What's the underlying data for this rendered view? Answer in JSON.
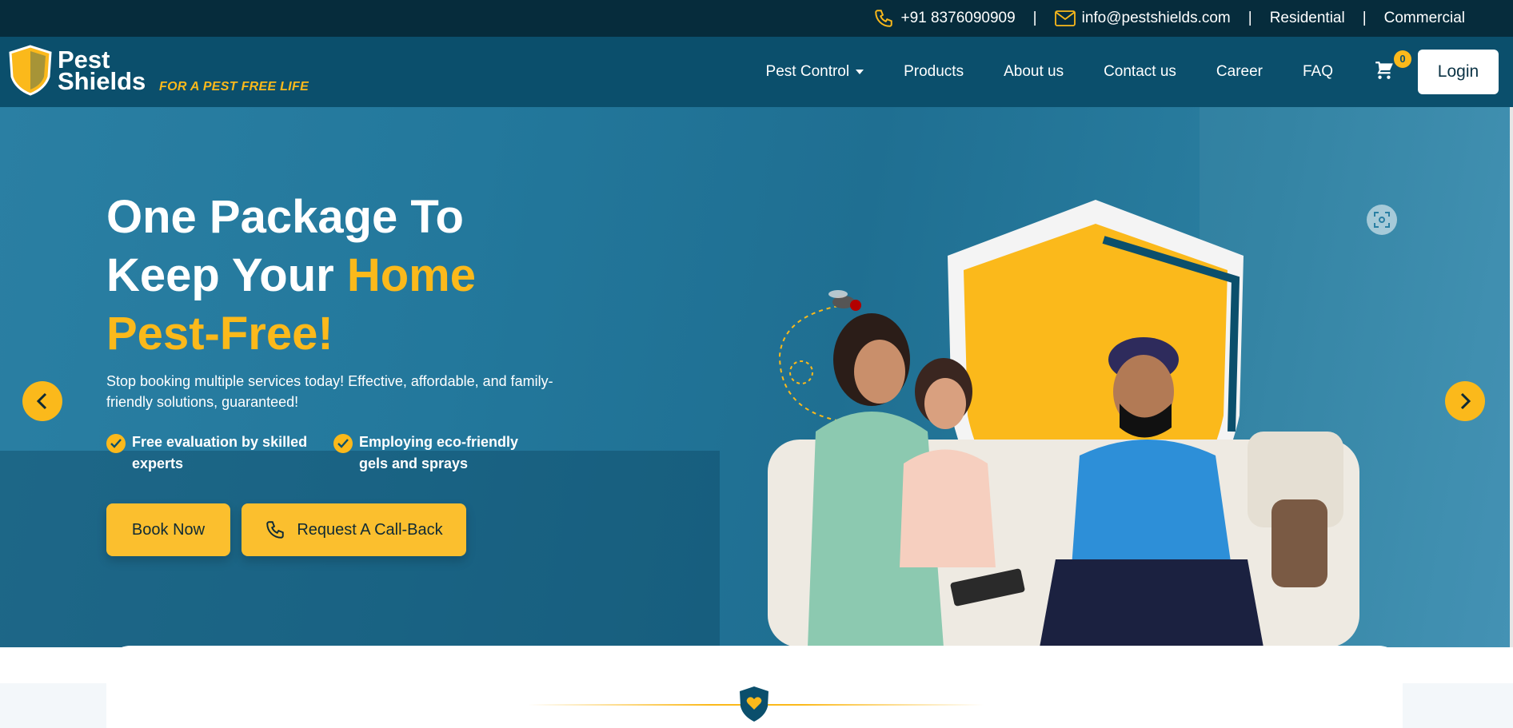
{
  "topbar": {
    "phone": "+91 8376090909",
    "email": "info@pestshields.com",
    "residential": "Residential",
    "commercial": "Commercial",
    "separator": "|"
  },
  "brand": {
    "line1": "Pest",
    "line2": "Shields",
    "tagline": "FOR A PEST FREE LIFE"
  },
  "nav": {
    "items": [
      "Pest Control",
      "Products",
      "About us",
      "Contact us",
      "Career",
      "FAQ"
    ],
    "cart_count": "0",
    "login": "Login"
  },
  "hero": {
    "headline_1": "One Package To",
    "headline_2": "Keep Your ",
    "headline_highlight_1": "Home",
    "headline_highlight_2": "Pest-Free!",
    "subtext": "Stop booking multiple services today! Effective, affordable, and family-friendly solutions, guaranteed!",
    "features": [
      "Free evaluation by skilled experts",
      "Employing eco-friendly gels and sprays"
    ],
    "book_now": "Book Now",
    "callback": "Request A Call-Back"
  },
  "colors": {
    "topbar_bg": "#062c3c",
    "navbar_bg": "#0b4f6c",
    "accent": "#fbb91b",
    "hero_bg": "#237a9e"
  },
  "icons": [
    "phone-icon",
    "mail-icon",
    "caret-down-icon",
    "cart-icon",
    "check-icon",
    "chevron-left-icon",
    "chevron-right-icon",
    "scan-icon",
    "shield-heart-icon"
  ]
}
